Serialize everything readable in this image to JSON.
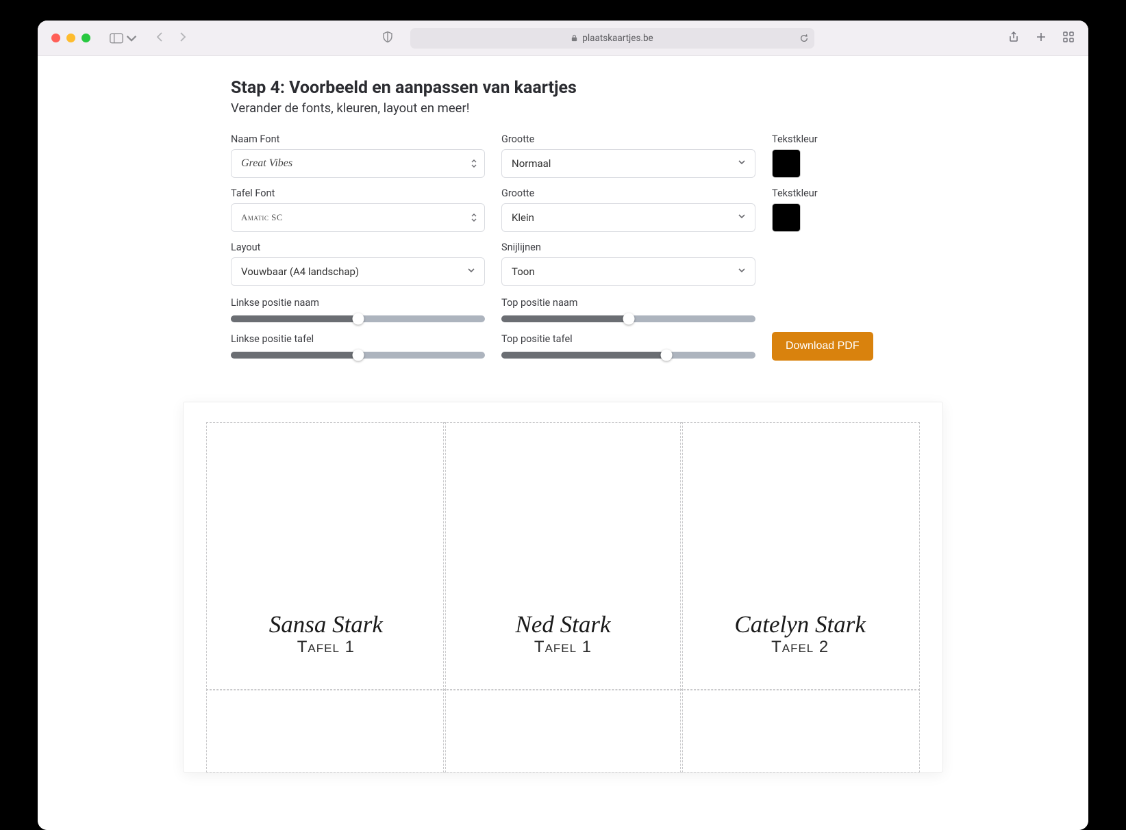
{
  "browser": {
    "url": "plaatskaartjes.be"
  },
  "page": {
    "title": "Stap 4: Voorbeeld en aanpassen van kaartjes",
    "subtitle": "Verander de fonts, kleuren, layout en meer!"
  },
  "labels": {
    "naam_font": "Naam Font",
    "grootte_1": "Grootte",
    "tekstkleur_1": "Tekstkleur",
    "tafel_font": "Tafel Font",
    "grootte_2": "Grootte",
    "tekstkleur_2": "Tekstkleur",
    "layout": "Layout",
    "snijlijnen": "Snijlijnen",
    "linkse_pos_naam": "Linkse positie naam",
    "top_pos_naam": "Top positie naam",
    "linkse_pos_tafel": "Linkse positie tafel",
    "top_pos_tafel": "Top positie tafel"
  },
  "values": {
    "naam_font": "Great Vibes",
    "grootte_1": "Normaal",
    "tekstkleur_1": "#000000",
    "tafel_font": "Amatic SC",
    "grootte_2": "Klein",
    "tekstkleur_2": "#000000",
    "layout": "Vouwbaar (A4 landschap)",
    "snijlijnen": "Toon",
    "slider_linkse_naam_pct": 50,
    "slider_top_naam_pct": 50,
    "slider_linkse_tafel_pct": 50,
    "slider_top_tafel_pct": 65
  },
  "buttons": {
    "download": "Download PDF"
  },
  "cards": [
    {
      "name": "Sansa Stark",
      "table": "Tafel 1"
    },
    {
      "name": "Ned Stark",
      "table": "Tafel 1"
    },
    {
      "name": "Catelyn Stark",
      "table": "Tafel 2"
    }
  ]
}
